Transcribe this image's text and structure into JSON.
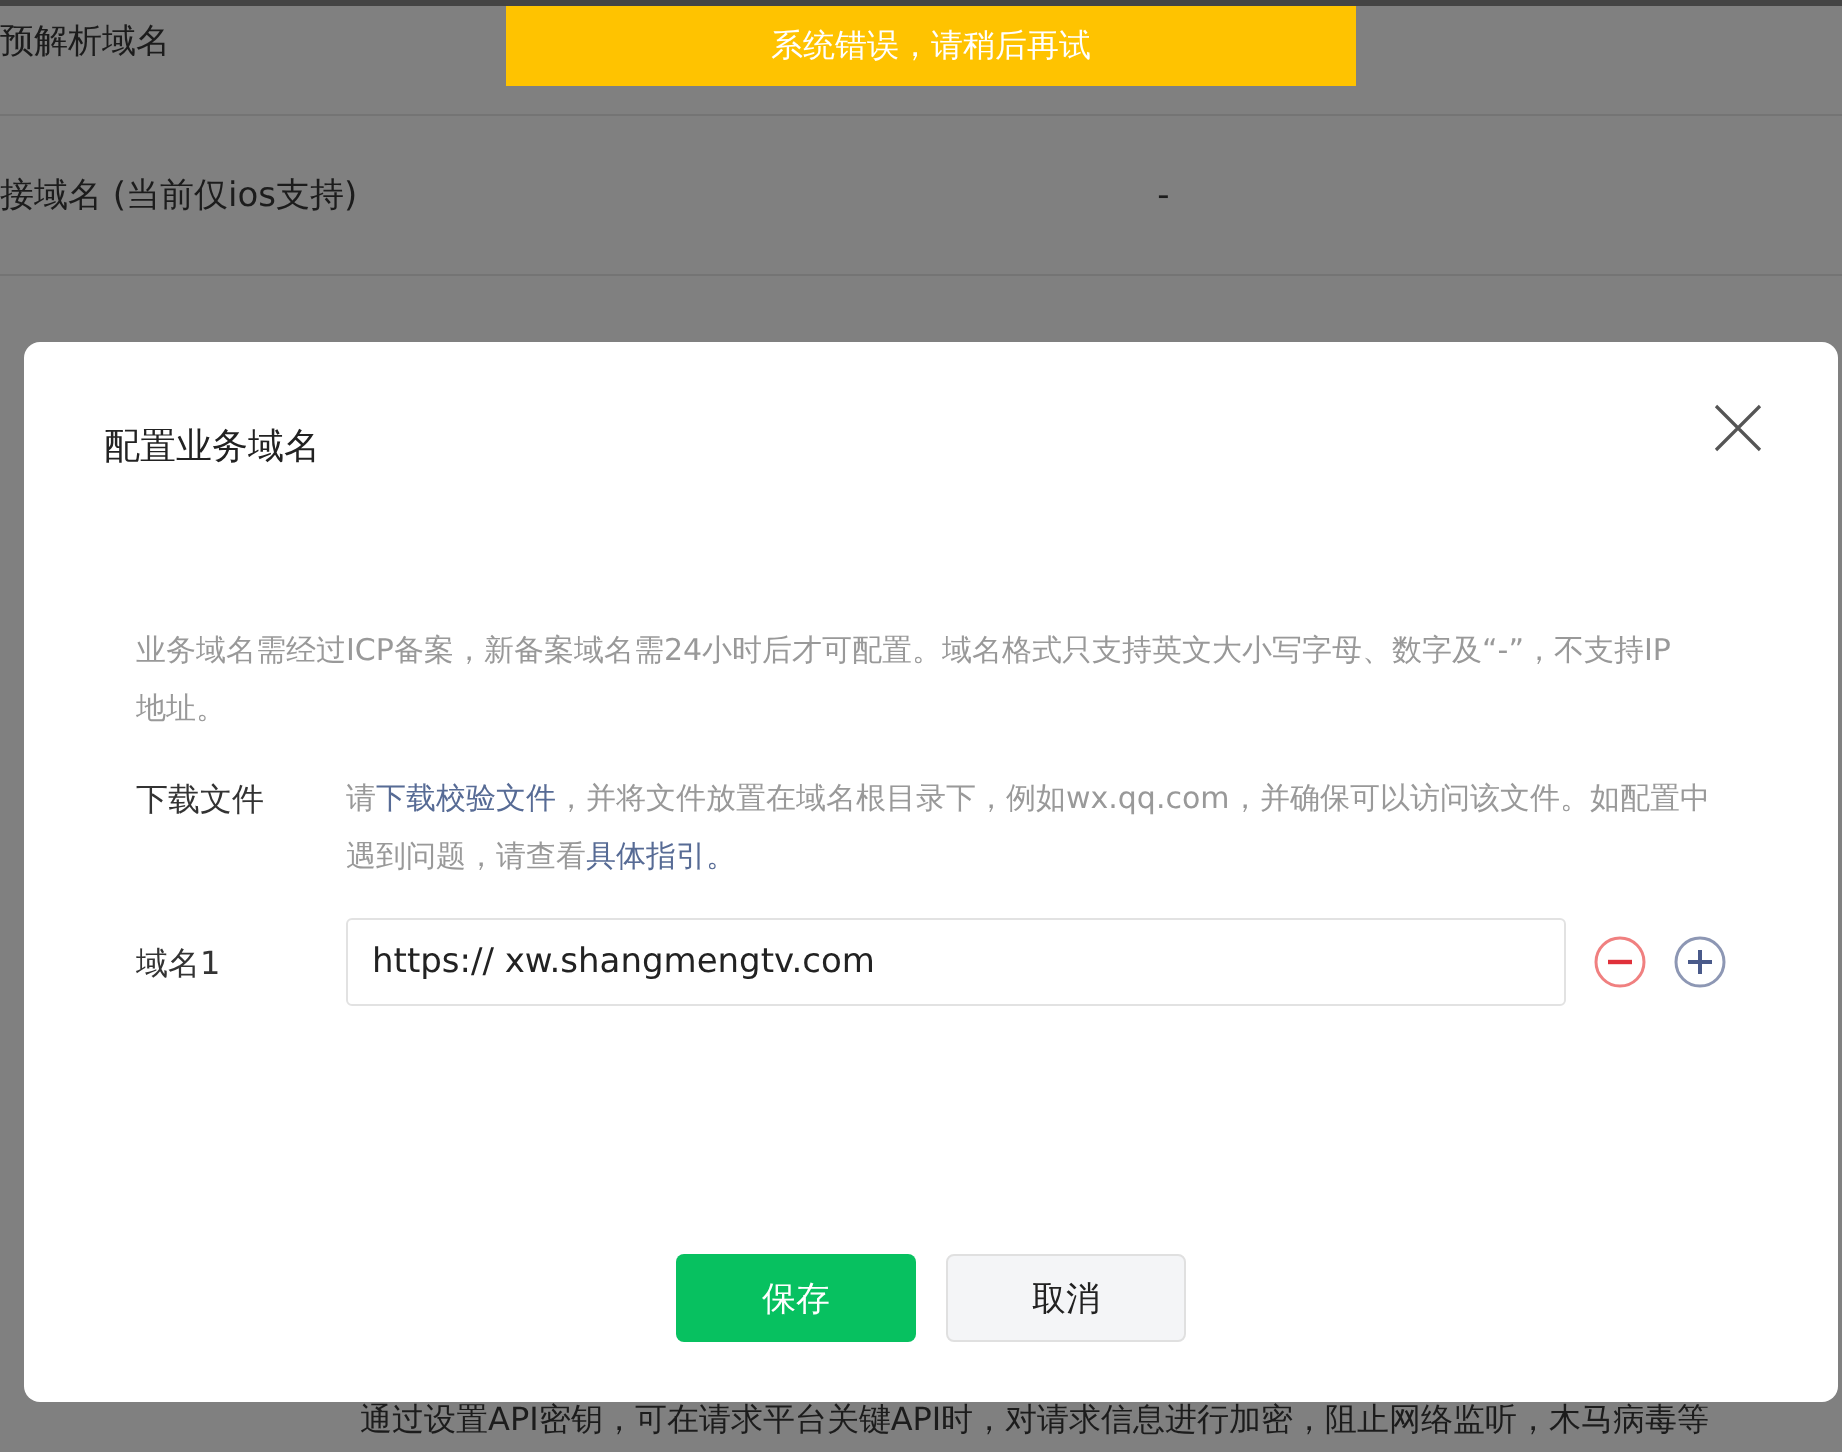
{
  "background": {
    "rows": [
      {
        "label": "预解析域名"
      },
      {
        "label": "接域名 (当前仅ios支持)",
        "value": "-"
      }
    ],
    "footer_text": "通过设置API密钥，可在请求平台关键API时，对请求信息进行加密，阻止网络监听，木马病毒等"
  },
  "toast": {
    "text": "系统错误，请稍后再试"
  },
  "dialog": {
    "title": "配置业务域名",
    "description": "业务域名需经过ICP备案，新备案域名需24小时后才可配置。域名格式只支持英文大小写字母、数字及“-”，不支持IP地址。",
    "fields": [
      {
        "kind": "text",
        "label": "下载文件",
        "parts": [
          {
            "text": "请",
            "link": false
          },
          {
            "text": "下载校验文件",
            "link": true
          },
          {
            "text": "，并将文件放置在域名根目录下，例如wx.qq.com，并确保可以访问该文件。如配置中遇到问题，请查看",
            "link": false
          },
          {
            "text": "具体指引。",
            "link": true
          }
        ]
      },
      {
        "kind": "input",
        "label": "域名1",
        "value": "https:// xw.shangmengtv.com"
      }
    ],
    "buttons": [
      {
        "label": "保存",
        "kind": "primary"
      },
      {
        "label": "取消",
        "kind": "secondary"
      }
    ]
  }
}
